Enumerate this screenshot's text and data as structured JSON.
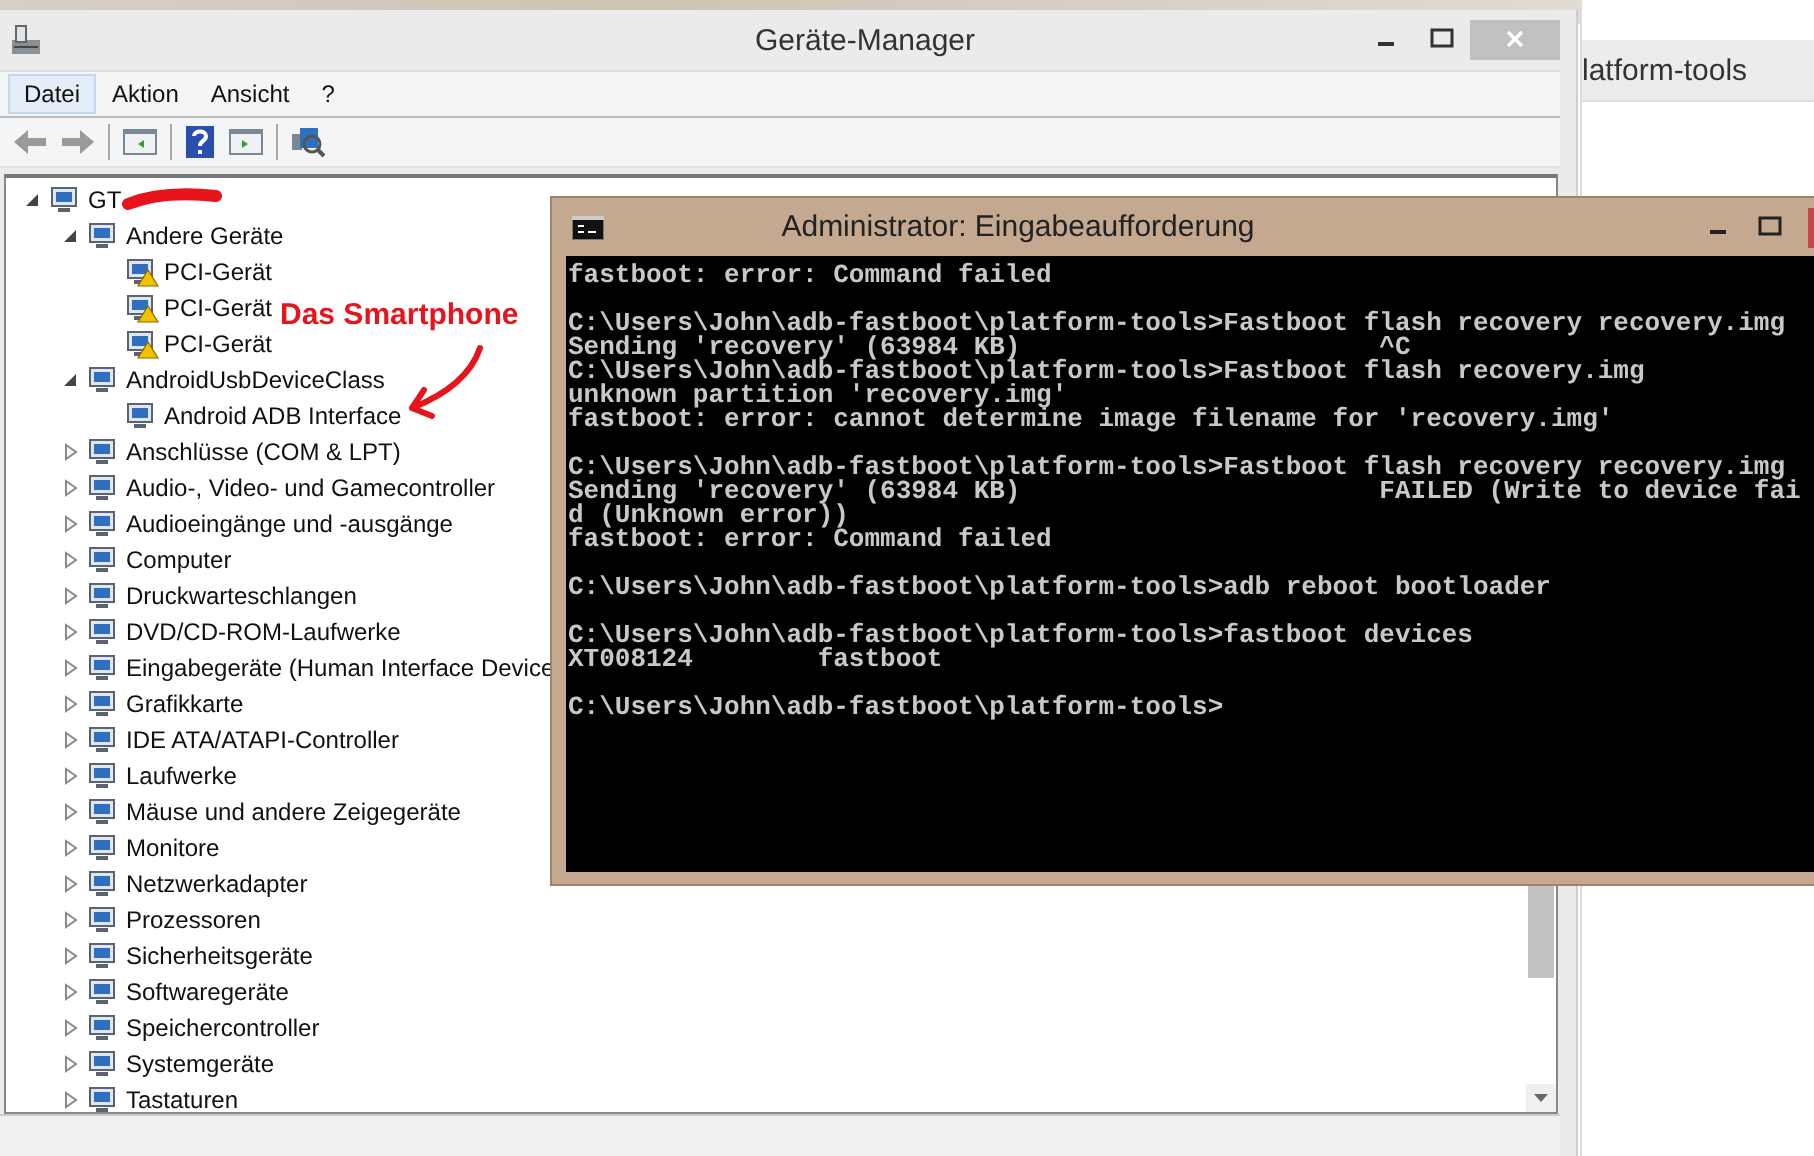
{
  "background_window": {
    "title": "latform-tools"
  },
  "device_manager": {
    "title": "Geräte-Manager",
    "menu": [
      {
        "label": "Datei",
        "selected": true
      },
      {
        "label": "Aktion",
        "selected": false
      },
      {
        "label": "Ansicht",
        "selected": false
      },
      {
        "label": "?",
        "selected": false
      }
    ],
    "tree": {
      "label": "GT",
      "expanded": true,
      "children": [
        {
          "label": "Andere Geräte",
          "expanded": true,
          "children": [
            {
              "label": "PCI-Gerät",
              "warning": true
            },
            {
              "label": "PCI-Gerät",
              "warning": true
            },
            {
              "label": "PCI-Gerät",
              "warning": true
            }
          ]
        },
        {
          "label": "AndroidUsbDeviceClass",
          "expanded": true,
          "children": [
            {
              "label": "Android ADB Interface",
              "warning": false
            }
          ]
        },
        {
          "label": "Anschlüsse (COM & LPT)",
          "expanded": false
        },
        {
          "label": "Audio-, Video- und Gamecontroller",
          "expanded": false
        },
        {
          "label": "Audioeingänge und -ausgänge",
          "expanded": false
        },
        {
          "label": "Computer",
          "expanded": false
        },
        {
          "label": "Druckwarteschlangen",
          "expanded": false
        },
        {
          "label": "DVD/CD-ROM-Laufwerke",
          "expanded": false
        },
        {
          "label": "Eingabegeräte (Human Interface Device",
          "expanded": false
        },
        {
          "label": "Grafikkarte",
          "expanded": false
        },
        {
          "label": "IDE ATA/ATAPI-Controller",
          "expanded": false
        },
        {
          "label": "Laufwerke",
          "expanded": false
        },
        {
          "label": "Mäuse und andere Zeigegeräte",
          "expanded": false
        },
        {
          "label": "Monitore",
          "expanded": false
        },
        {
          "label": "Netzwerkadapter",
          "expanded": false
        },
        {
          "label": "Prozessoren",
          "expanded": false
        },
        {
          "label": "Sicherheitsgeräte",
          "expanded": false
        },
        {
          "label": "Softwaregeräte",
          "expanded": false
        },
        {
          "label": "Speichercontroller",
          "expanded": false
        },
        {
          "label": "Systemgeräte",
          "expanded": false
        },
        {
          "label": "Tastaturen",
          "expanded": false
        }
      ]
    }
  },
  "annotation": {
    "text": "Das Smartphone"
  },
  "command_prompt": {
    "title": "Administrator: Eingabeaufforderung",
    "blocks": [
      [
        "fastboot: error: Command failed"
      ],
      [
        "C:\\Users\\John\\adb-fastboot\\platform-tools>Fastboot flash recovery recovery.img",
        "Sending 'recovery' (63984 KB)                       ^C",
        "C:\\Users\\John\\adb-fastboot\\platform-tools>Fastboot flash recovery.img",
        "unknown partition 'recovery.img'",
        "fastboot: error: cannot determine image filename for 'recovery.img'"
      ],
      [
        "C:\\Users\\John\\adb-fastboot\\platform-tools>Fastboot flash recovery recovery.img",
        "Sending 'recovery' (63984 KB)                       FAILED (Write to device fai",
        "d (Unknown error))",
        "fastboot: error: Command failed"
      ],
      [
        "C:\\Users\\John\\adb-fastboot\\platform-tools>adb reboot bootloader"
      ],
      [
        "C:\\Users\\John\\adb-fastboot\\platform-tools>fastboot devices",
        "XT008124        fastboot"
      ],
      [
        "C:\\Users\\John\\adb-fastboot\\platform-tools>"
      ]
    ]
  }
}
